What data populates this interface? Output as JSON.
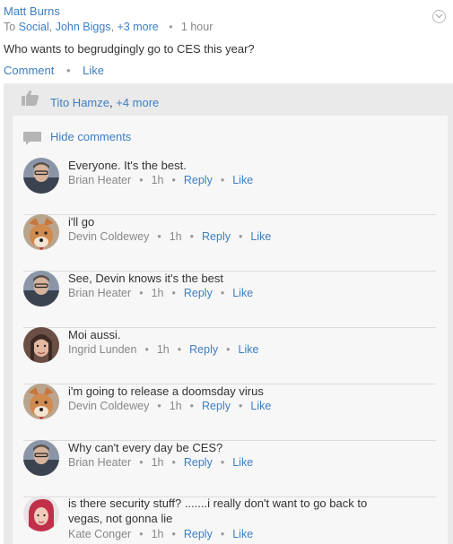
{
  "post": {
    "author": "Matt Burns",
    "to_prefix": "To",
    "recipients": [
      "Social",
      "John Biggs"
    ],
    "more": "+3 more",
    "time": "1 hour",
    "text": "Who wants to begrudgingly go to CES this year?",
    "actions": {
      "comment": "Comment",
      "like": "Like"
    }
  },
  "likes": {
    "name": "Tito Hamze",
    "more": "+4 more"
  },
  "hide_comments": "Hide comments",
  "comments": [
    {
      "text": "Everyone. It's the best.",
      "author": "Brian Heater",
      "time": "1h",
      "reply": "Reply",
      "like": "Like"
    },
    {
      "text": "i'll go",
      "author": "Devin Coldewey",
      "time": "1h",
      "reply": "Reply",
      "like": "Like"
    },
    {
      "text": "See, Devin knows it's the best",
      "author": "Brian Heater",
      "time": "1h",
      "reply": "Reply",
      "like": "Like"
    },
    {
      "text": "Moi aussi.",
      "author": "Ingrid Lunden",
      "time": "1h",
      "reply": "Reply",
      "like": "Like"
    },
    {
      "text": "i'm going to release a doomsday virus",
      "author": "Devin Coldewey",
      "time": "1h",
      "reply": "Reply",
      "like": "Like"
    },
    {
      "text": "Why can't every day be CES?",
      "author": "Brian Heater",
      "time": "1h",
      "reply": "Reply",
      "like": "Like"
    },
    {
      "text": "is there security stuff? .......i really don't want to go back to vegas, not gonna lie",
      "author": "Kate Conger",
      "time": "1h",
      "reply": "Reply",
      "like": "Like"
    }
  ],
  "colors": {
    "link": "#3e7ec2",
    "panel": "#eaeaea",
    "comments_bg": "#f7f7f7",
    "meta": "#888888"
  }
}
